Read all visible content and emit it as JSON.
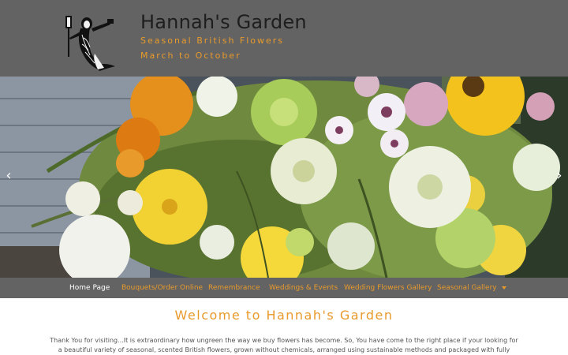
{
  "header": {
    "title": "Hannah's Garden",
    "tagline_1": "Seasonal British Flowers",
    "tagline_2": "March to October",
    "logo_icon": "mermaid-logo-icon"
  },
  "slider": {
    "prev_label": "‹",
    "next_label": "›",
    "prev_icon": "chevron-left-icon",
    "next_icon": "chevron-right-icon"
  },
  "nav": {
    "items": [
      {
        "label": "Home Page"
      },
      {
        "label": "Bouquets/Order Online"
      },
      {
        "label": "Remembrance"
      },
      {
        "label": "Weddings & Events"
      },
      {
        "label": "Wedding Flowers Gallery"
      },
      {
        "label": "Seasonal Gallery"
      }
    ]
  },
  "main": {
    "heading": "Welcome to Hannah's Garden",
    "intro": "Thank You for visiting...It is extraordinary how ungreen the way we buy flowers has become. So, You have come to the right place if your looking for a beautiful variety of seasonal, scented British flowers, grown without chemicals, arranged using sustainable methods and packaged with fully biodegradable materials."
  },
  "colors": {
    "header_bg": "#636363",
    "accent": "#e89a2b",
    "nav_active": "#ffffff"
  }
}
